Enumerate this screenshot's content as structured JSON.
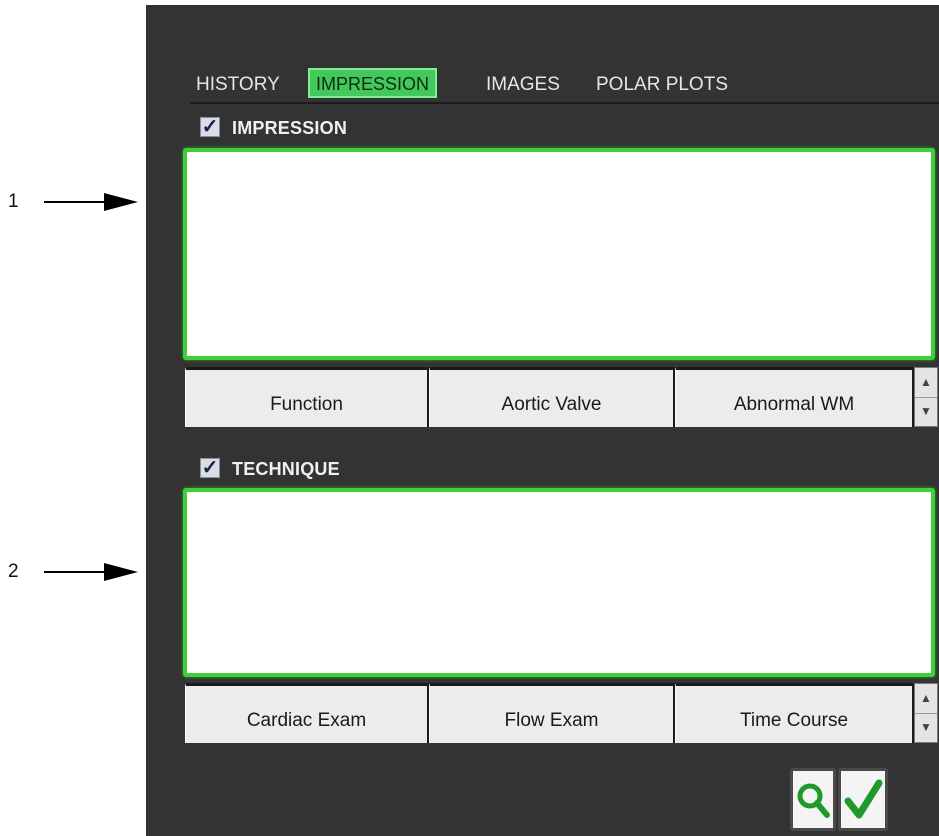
{
  "callouts": [
    {
      "number": "1"
    },
    {
      "number": "2"
    }
  ],
  "tabs": [
    {
      "label": "HISTORY",
      "active": false
    },
    {
      "label": "IMPRESSION",
      "active": true
    },
    {
      "label": "IMAGES",
      "active": false
    },
    {
      "label": "POLAR PLOTS",
      "active": false
    }
  ],
  "impression": {
    "label": "IMPRESSION",
    "checked": true,
    "text": "",
    "quick_buttons": [
      "Function",
      "Aortic Valve",
      "Abnormal WM"
    ]
  },
  "technique": {
    "label": "TECHNIQUE",
    "checked": true,
    "text": "",
    "quick_buttons": [
      "Cardiac Exam",
      "Flow Exam",
      "Time Course"
    ]
  },
  "colors": {
    "panel": "#333333",
    "accent_green": "#44c85e",
    "text_light": "#e6e6e6"
  },
  "icons": {
    "search": "magnifier-icon",
    "accept": "checkmark-icon",
    "checkbox": "checkbox-checked-icon"
  }
}
